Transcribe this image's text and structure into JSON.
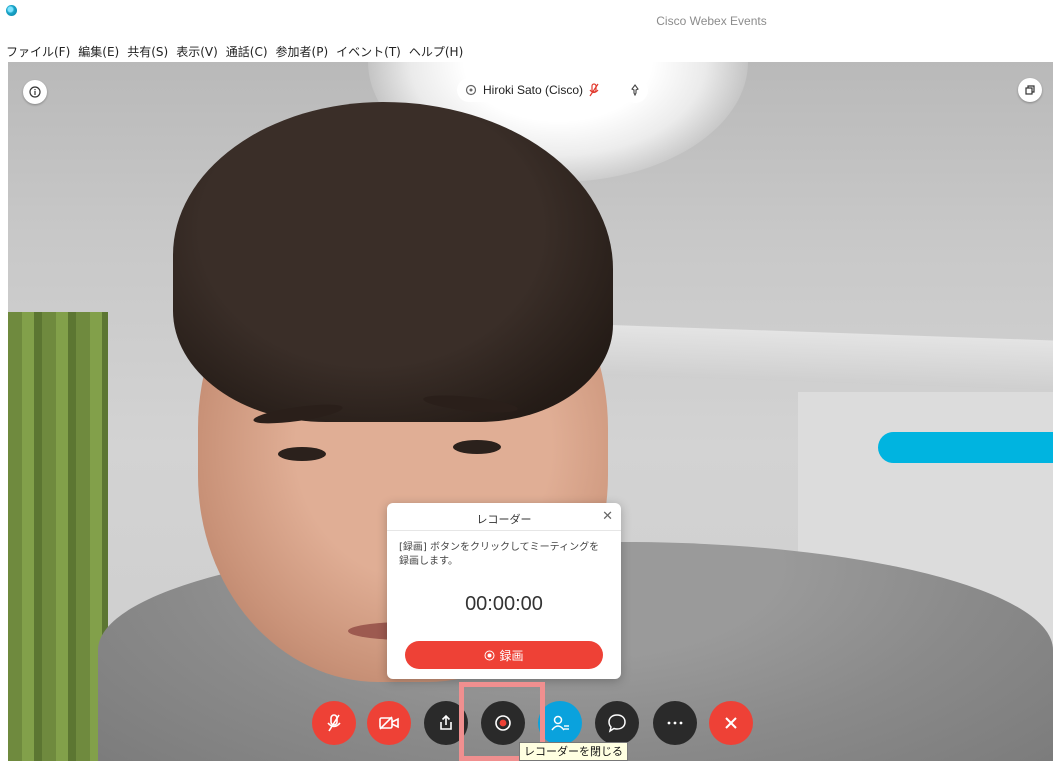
{
  "window": {
    "title": "Cisco Webex Events"
  },
  "menubar": {
    "items": [
      {
        "label": "ファイル(F)"
      },
      {
        "label": "編集(E)"
      },
      {
        "label": "共有(S)"
      },
      {
        "label": "表示(V)"
      },
      {
        "label": "通話(C)"
      },
      {
        "label": "参加者(P)"
      },
      {
        "label": "イベント(T)"
      },
      {
        "label": "ヘルプ(H)"
      }
    ]
  },
  "video": {
    "speaker_name": "Hiroki Sato (Cisco)",
    "icons": {
      "info": "info-icon",
      "pin": "pin-icon",
      "layout": "layout-icon",
      "mic_status": "muted-mic-icon"
    },
    "accent": "#00b4e0"
  },
  "recorder": {
    "title": "レコーダー",
    "description": "[録画] ボタンをクリックしてミーティングを録画します。",
    "timer": "00:00:00",
    "record_button": "録画"
  },
  "controls": {
    "buttons": [
      {
        "name": "mute-button",
        "icon": "muted-mic-icon"
      },
      {
        "name": "stop-video-button",
        "icon": "video-off-icon"
      },
      {
        "name": "share-button",
        "icon": "share-icon"
      },
      {
        "name": "recorder-button",
        "icon": "record-icon"
      },
      {
        "name": "participants-button",
        "icon": "participants-icon"
      },
      {
        "name": "chat-button",
        "icon": "chat-icon"
      },
      {
        "name": "more-button",
        "icon": "more-icon"
      },
      {
        "name": "leave-button",
        "icon": "close-icon"
      }
    ],
    "tooltip": "レコーダーを閉じる",
    "colors": {
      "red": "#ee4136",
      "dark": "#2a2a2a",
      "blue": "#0aa2dd"
    }
  }
}
